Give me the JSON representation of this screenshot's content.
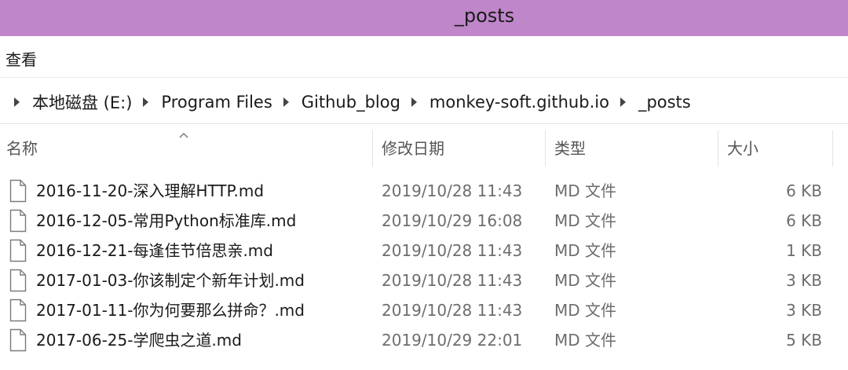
{
  "window": {
    "title": "_posts",
    "titlebar_color": "#bf86c9"
  },
  "menu": {
    "view_label": "查看"
  },
  "address": {
    "crumbs": [
      "本地磁盘 (E:)",
      "Program Files",
      "Github_blog",
      "monkey-soft.github.io",
      "_posts"
    ],
    "separator_icon": "chevron-right-icon"
  },
  "columns": {
    "name": "名称",
    "modified": "修改日期",
    "type": "类型",
    "size": "大小",
    "sort_icon": "sort-ascending-icon"
  },
  "files": [
    {
      "name": "2016-11-20-深入理解HTTP.md",
      "modified": "2019/10/28 11:43",
      "type": "MD 文件",
      "size": "6 KB",
      "icon": "file-icon"
    },
    {
      "name": "2016-12-05-常用Python标准库.md",
      "modified": "2019/10/29 16:08",
      "type": "MD 文件",
      "size": "6 KB",
      "icon": "file-icon"
    },
    {
      "name": "2016-12-21-每逢佳节倍思亲.md",
      "modified": "2019/10/28 11:43",
      "type": "MD 文件",
      "size": "1 KB",
      "icon": "file-icon"
    },
    {
      "name": "2017-01-03-你该制定个新年计划.md",
      "modified": "2019/10/28 11:43",
      "type": "MD 文件",
      "size": "3 KB",
      "icon": "file-icon"
    },
    {
      "name": "2017-01-11-你为何要那么拼命？.md",
      "modified": "2019/10/28 11:43",
      "type": "MD 文件",
      "size": "3 KB",
      "icon": "file-icon"
    },
    {
      "name": "2017-06-25-学爬虫之道.md",
      "modified": "2019/10/29 22:01",
      "type": "MD 文件",
      "size": "5 KB",
      "icon": "file-icon"
    }
  ]
}
